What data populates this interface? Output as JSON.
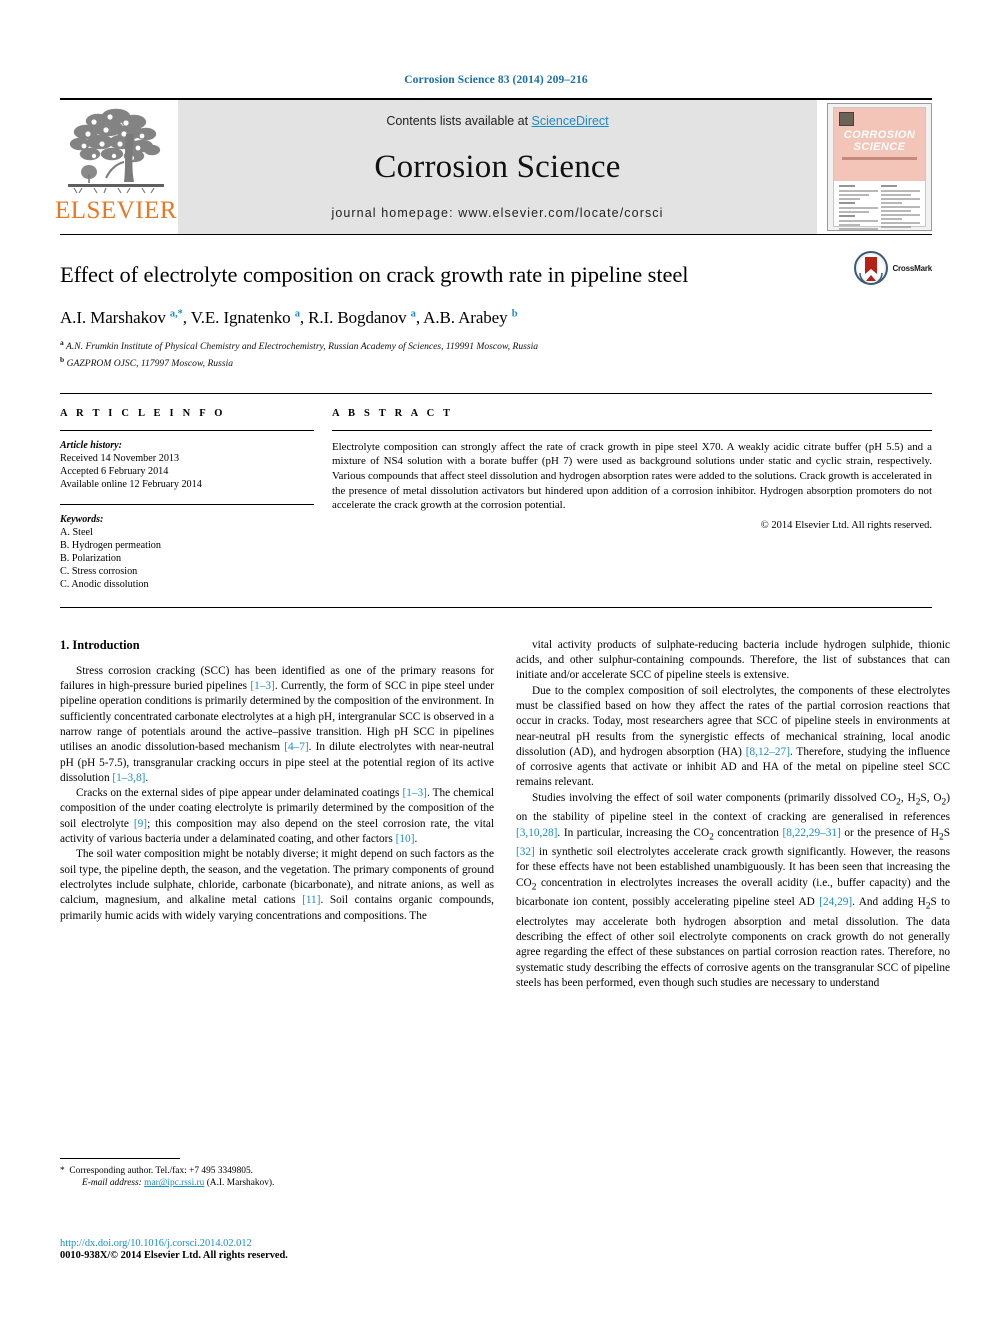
{
  "running_head": "Corrosion Science 83 (2014) 209–216",
  "masthead": {
    "publisher": "ELSEVIER",
    "contents_prefix": "Contents lists available at ",
    "contents_link": "ScienceDirect",
    "journal_name": "Corrosion Science",
    "homepage": "journal homepage: www.elsevier.com/locate/corsci",
    "cover_title_line1": "CORROSION",
    "cover_title_line2": "SCIENCE"
  },
  "article": {
    "title": "Effect of electrolyte composition on crack growth rate in pipeline steel",
    "crossmark_label": "CrossMark",
    "authors_html": "A.I. Marshakov <sup>a,*</sup>, V.E. Ignatenko <sup>a</sup>, R.I. Bogdanov <sup>a</sup>, A.B. Arabey <sup>b</sup>",
    "affiliation_a": "A.N. Frumkin Institute of Physical Chemistry and Electrochemistry, Russian Academy of Sciences, 119991 Moscow, Russia",
    "affiliation_b": "GAZPROM OJSC, 117997 Moscow, Russia"
  },
  "info": {
    "heading": "A R T I C L E     I N F O",
    "history_label": "Article history:",
    "received": "Received 14 November 2013",
    "accepted": "Accepted 6 February 2014",
    "available": "Available online 12 February 2014",
    "keywords_label": "Keywords:",
    "keywords": [
      "A. Steel",
      "B. Hydrogen permeation",
      "B. Polarization",
      "C. Stress corrosion",
      "C. Anodic dissolution"
    ]
  },
  "abstract": {
    "heading": "A B S T R A C T",
    "text": "Electrolyte composition can strongly affect the rate of crack growth in pipe steel X70. A weakly acidic citrate buffer (pH 5.5) and a mixture of NS4 solution with a borate buffer (pH 7) were used as background solutions under static and cyclic strain, respectively. Various compounds that affect steel dissolution and hydrogen absorption rates were added to the solutions. Crack growth is accelerated in the presence of metal dissolution activators but hindered upon addition of a corrosion inhibitor. Hydrogen absorption promoters do not accelerate the crack growth at the corrosion potential.",
    "copyright": "© 2014 Elsevier Ltd. All rights reserved."
  },
  "body": {
    "section_title": "1. Introduction",
    "left_paragraphs": [
      "Stress corrosion cracking (SCC) has been identified as one of the primary reasons for failures in high-pressure buried pipelines [1–3]. Currently, the form of SCC in pipe steel under pipeline operation conditions is primarily determined by the composition of the environment. In sufficiently concentrated carbonate electrolytes at a high pH, intergranular SCC is observed in a narrow range of potentials around the active–passive transition. High pH SCC in pipelines utilises an anodic dissolution-based mechanism [4–7]. In dilute electrolytes with near-neutral pH (pH 5-7.5), transgranular cracking occurs in pipe steel at the potential region of its active dissolution [1–3,8].",
      "Cracks on the external sides of pipe appear under delaminated coatings [1–3]. The chemical composition of the under coating electrolyte is primarily determined by the composition of the soil electrolyte [9]; this composition may also depend on the steel corrosion rate, the vital activity of various bacteria under a delaminated coating, and other factors [10].",
      "The soil water composition might be notably diverse; it might depend on such factors as the soil type, the pipeline depth, the season, and the vegetation. The primary components of ground electrolytes include sulphate, chloride, carbonate (bicarbonate), and nitrate anions, as well as calcium, magnesium, and alkaline metal cations [11]. Soil contains organic compounds, primarily humic acids with widely varying concentrations and compositions. The"
    ],
    "right_paragraphs": [
      "vital activity products of sulphate-reducing bacteria include hydrogen sulphide, thionic acids, and other sulphur-containing compounds. Therefore, the list of substances that can initiate and/or accelerate SCC of pipeline steels is extensive.",
      "Due to the complex composition of soil electrolytes, the components of these electrolytes must be classified based on how they affect the rates of the partial corrosion reactions that occur in cracks. Today, most researchers agree that SCC of pipeline steels in environments at near-neutral pH results from the synergistic effects of mechanical straining, local anodic dissolution (AD), and hydrogen absorption (HA) [8,12–27]. Therefore, studying the influence of corrosive agents that activate or inhibit AD and HA of the metal on pipeline steel SCC remains relevant.",
      "Studies involving the effect of soil water components (primarily dissolved CO2, H2S, O2) on the stability of pipeline steel in the context of cracking are generalised in references [3,10,28]. In particular, increasing the CO2 concentration [8,22,29–31] or the presence of H2S [32] in synthetic soil electrolytes accelerate crack growth significantly. However, the reasons for these effects have not been established unambiguously. It has been seen that increasing the CO2 concentration in electrolytes increases the overall acidity (i.e., buffer capacity) and the bicarbonate ion content, possibly accelerating pipeline steel AD [24,29]. And adding H2S to electrolytes may accelerate both hydrogen absorption and metal dissolution. The data describing the effect of other soil electrolyte components on crack growth do not generally agree regarding the effect of these substances on partial corrosion reaction rates. Therefore, no systematic study describing the effects of corrosive agents on the transgranular SCC of pipeline steels has been performed, even though such studies are necessary to understand"
    ]
  },
  "footnote": {
    "corresponding": "Corresponding author. Tel./fax: +7 495 3349805.",
    "email_label": "E-mail address:",
    "email": "mar@ipc.rssi.ru",
    "email_suffix": "(A.I. Marshakov)."
  },
  "footer": {
    "doi": "http://dx.doi.org/10.1016/j.corsci.2014.02.012",
    "issn_line": "0010-938X/© 2014 Elsevier Ltd. All rights reserved."
  },
  "colors": {
    "link": "#1a8cc8",
    "elsevier_orange": "#E87722",
    "cover_pink": "#f3c4b8"
  }
}
